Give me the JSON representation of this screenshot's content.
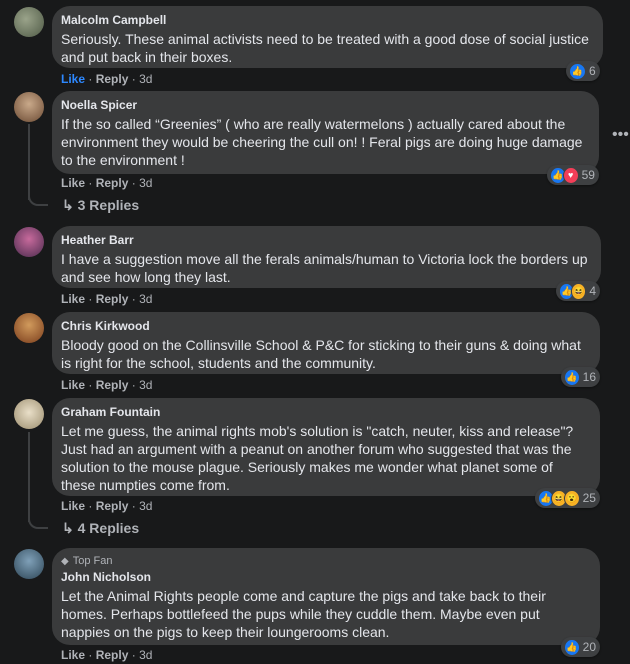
{
  "comments": [
    {
      "name": "Malcolm Campbell",
      "text": "Seriously. These animal activists need to be treated with a good dose of social justice and put back in their boxes.",
      "like": "Like",
      "reply": "Reply",
      "time": "3d",
      "reaction_count": "6",
      "reactions": [
        "like"
      ]
    },
    {
      "name": "Noella Spicer",
      "text": "If the so called “Greenies” ( who are really watermelons ) actually cared about the environment they would be cheering the cull on! ! Feral pigs are doing huge damage to the environment !",
      "like": "Like",
      "reply": "Reply",
      "time": "3d",
      "reaction_count": "59",
      "reactions": [
        "like",
        "love"
      ],
      "replies": "3 Replies"
    },
    {
      "name": "Heather Barr",
      "text": "I have a suggestion move all the ferals animals/human to Victoria lock the borders up and see how long they last.",
      "like": "Like",
      "reply": "Reply",
      "time": "3d",
      "reaction_count": "4",
      "reactions": [
        "like",
        "haha"
      ]
    },
    {
      "name": "Chris Kirkwood",
      "text": "Bloody good on the Collinsville School & P&C for sticking to their guns & doing what is right for the school, students and the community.",
      "like": "Like",
      "reply": "Reply",
      "time": "3d",
      "reaction_count": "16",
      "reactions": [
        "like"
      ]
    },
    {
      "name": "Graham Fountain",
      "text": "Let me guess, the animal rights mob's solution is \"catch, neuter, kiss and release\"? Just had an argument with a peanut on another forum who suggested that was the solution to the mouse plague. Seriously makes me wonder what planet some of these numpties come from.",
      "like": "Like",
      "reply": "Reply",
      "time": "3d",
      "reaction_count": "25",
      "reactions": [
        "like",
        "haha",
        "wow"
      ],
      "replies": "4 Replies"
    },
    {
      "badge": "Top Fan",
      "name": "John Nicholson",
      "text": "Let the Animal Rights people come and capture the pigs and take back to their homes. Perhaps bottlefeed the pups while they cuddle them. Maybe even put nappies on the pigs to keep their loungerooms clean.",
      "like": "Like",
      "reply": "Reply",
      "time": "3d",
      "reaction_count": "20",
      "reactions": [
        "like"
      ]
    }
  ],
  "more_options": "•••",
  "colors": {
    "background": "#18191a",
    "bubble": "#3a3b3c",
    "like_active": "#2d88ff",
    "secondary_text": "#b0b3b8"
  }
}
